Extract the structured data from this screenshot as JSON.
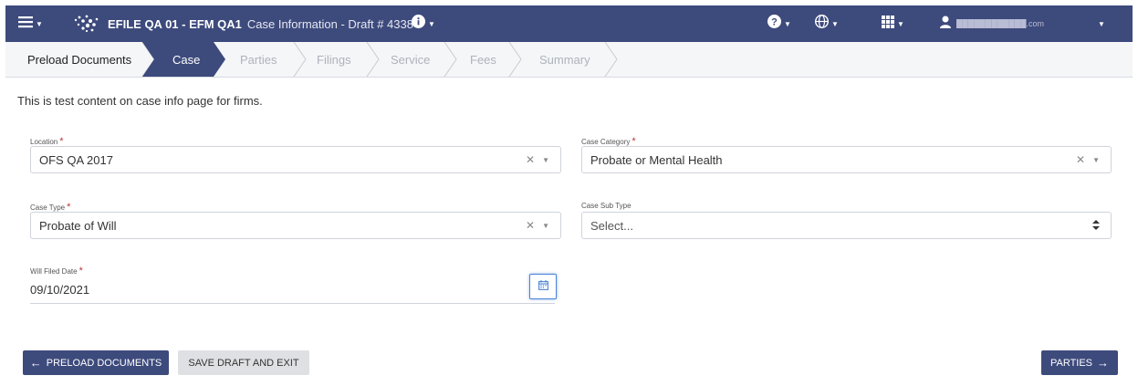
{
  "header": {
    "brand": "EFILE QA 01 - EFM QA1",
    "subtitle": "Case Information - Draft # 4338",
    "user_email": "████████████.com"
  },
  "colors": {
    "nav": "#3d4a7c",
    "required": "#b33a3a",
    "focus": "#4b84d6"
  },
  "steps": [
    {
      "label": "Preload Documents",
      "state": "completed"
    },
    {
      "label": "Case",
      "state": "active"
    },
    {
      "label": "Parties",
      "state": "disabled"
    },
    {
      "label": "Filings",
      "state": "disabled"
    },
    {
      "label": "Service",
      "state": "disabled"
    },
    {
      "label": "Fees",
      "state": "disabled"
    },
    {
      "label": "Summary",
      "state": "disabled"
    }
  ],
  "main": {
    "intro": "This is test content on case info page for firms.",
    "location": {
      "label": "Location",
      "value": "OFS QA 2017"
    },
    "case_category": {
      "label": "Case Category",
      "value": "Probate or Mental Health"
    },
    "case_type": {
      "label": "Case Type",
      "value": "Probate of Will"
    },
    "case_sub_type": {
      "label": "Case Sub Type",
      "placeholder": "Select..."
    },
    "will_filed_date": {
      "label": "Will Filed Date",
      "value": "09/10/2021"
    }
  },
  "actions": {
    "back": "PRELOAD DOCUMENTS",
    "save": "SAVE DRAFT AND EXIT",
    "next": "PARTIES"
  }
}
